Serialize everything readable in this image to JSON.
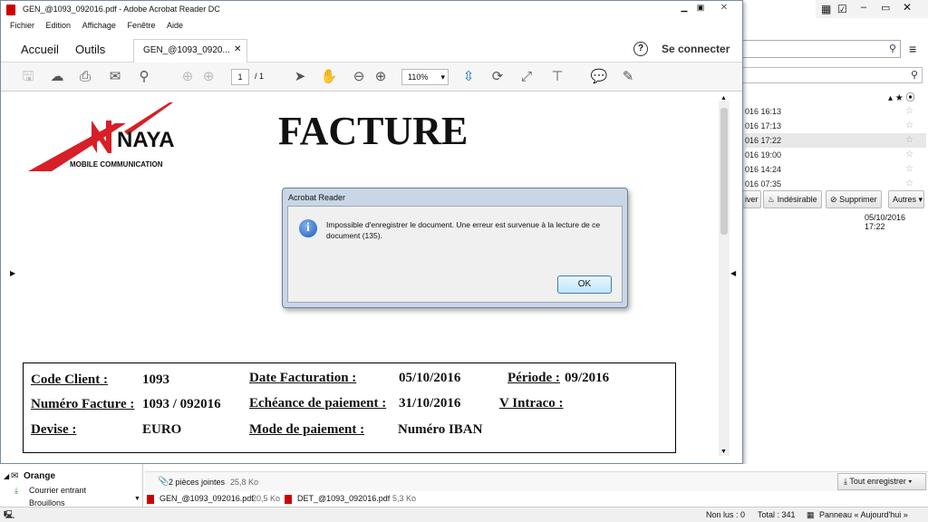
{
  "window": {
    "title": "GEN_@1093_092016.pdf - Adobe Acrobat Reader DC"
  },
  "menu": [
    "Fichier",
    "Edition",
    "Affichage",
    "Fenêtre",
    "Aide"
  ],
  "tabs": {
    "home": "Accueil",
    "tools": "Outils",
    "doc": "GEN_@1093_0920...",
    "connect": "Se connecter"
  },
  "toolbar": {
    "page_current": "1",
    "page_total": "/ 1",
    "zoom": "110%"
  },
  "invoice": {
    "title": "FACTURE",
    "logo_name": "NAYA",
    "logo_sub": "MOBILE COMMUNICATION",
    "code_client_label": "Code Client :",
    "code_client": "1093",
    "date_fact_label": "Date Facturation :",
    "date_fact": "05/10/2016",
    "periode_label": "Période :",
    "periode": "09/2016",
    "num_fact_label": "Numéro Facture :",
    "num_fact": "1093 / 092016",
    "echeance_label": "Echéance de paiement :",
    "echeance": "31/10/2016",
    "vintraco_label": "V Intraco :",
    "devise_label": "Devise :",
    "devise": "EURO",
    "mode_label": "Mode de paiement :",
    "mode": "Numéro IBAN"
  },
  "dialog": {
    "title": "Acrobat Reader",
    "message_1": "Impossible d'enregistrer le document. Une erreur est survenue à la lecture de ce",
    "message_2": "document (135).",
    "ok": "OK"
  },
  "mail": {
    "rows": [
      "016 16:13",
      "016 17:13",
      "016 17:22",
      "016 19:00",
      "016 14:24",
      "016 07:35"
    ],
    "buttons": {
      "archive": "iver",
      "junk": "Indésirable",
      "delete": "Supprimer",
      "more": "Autres"
    },
    "date": "05/10/2016 17:22",
    "attach_count": "2 pièces jointes",
    "attach_size": "25,8 Ko",
    "save_all": "Tout enregistrer",
    "att1_name": "GEN_@1093_092016.pdf",
    "att1_size": "20,5 Ko",
    "att2_name": "DET_@1093_092016.pdf",
    "att2_size": "5,3 Ko",
    "folder_orange": "Orange",
    "folder_inbox": "Courrier entrant",
    "folder_drafts": "Brouillons"
  },
  "status": {
    "unread": "Non lus : 0",
    "total": "Total : 341",
    "panel": "Panneau « Aujourd'hui »"
  }
}
